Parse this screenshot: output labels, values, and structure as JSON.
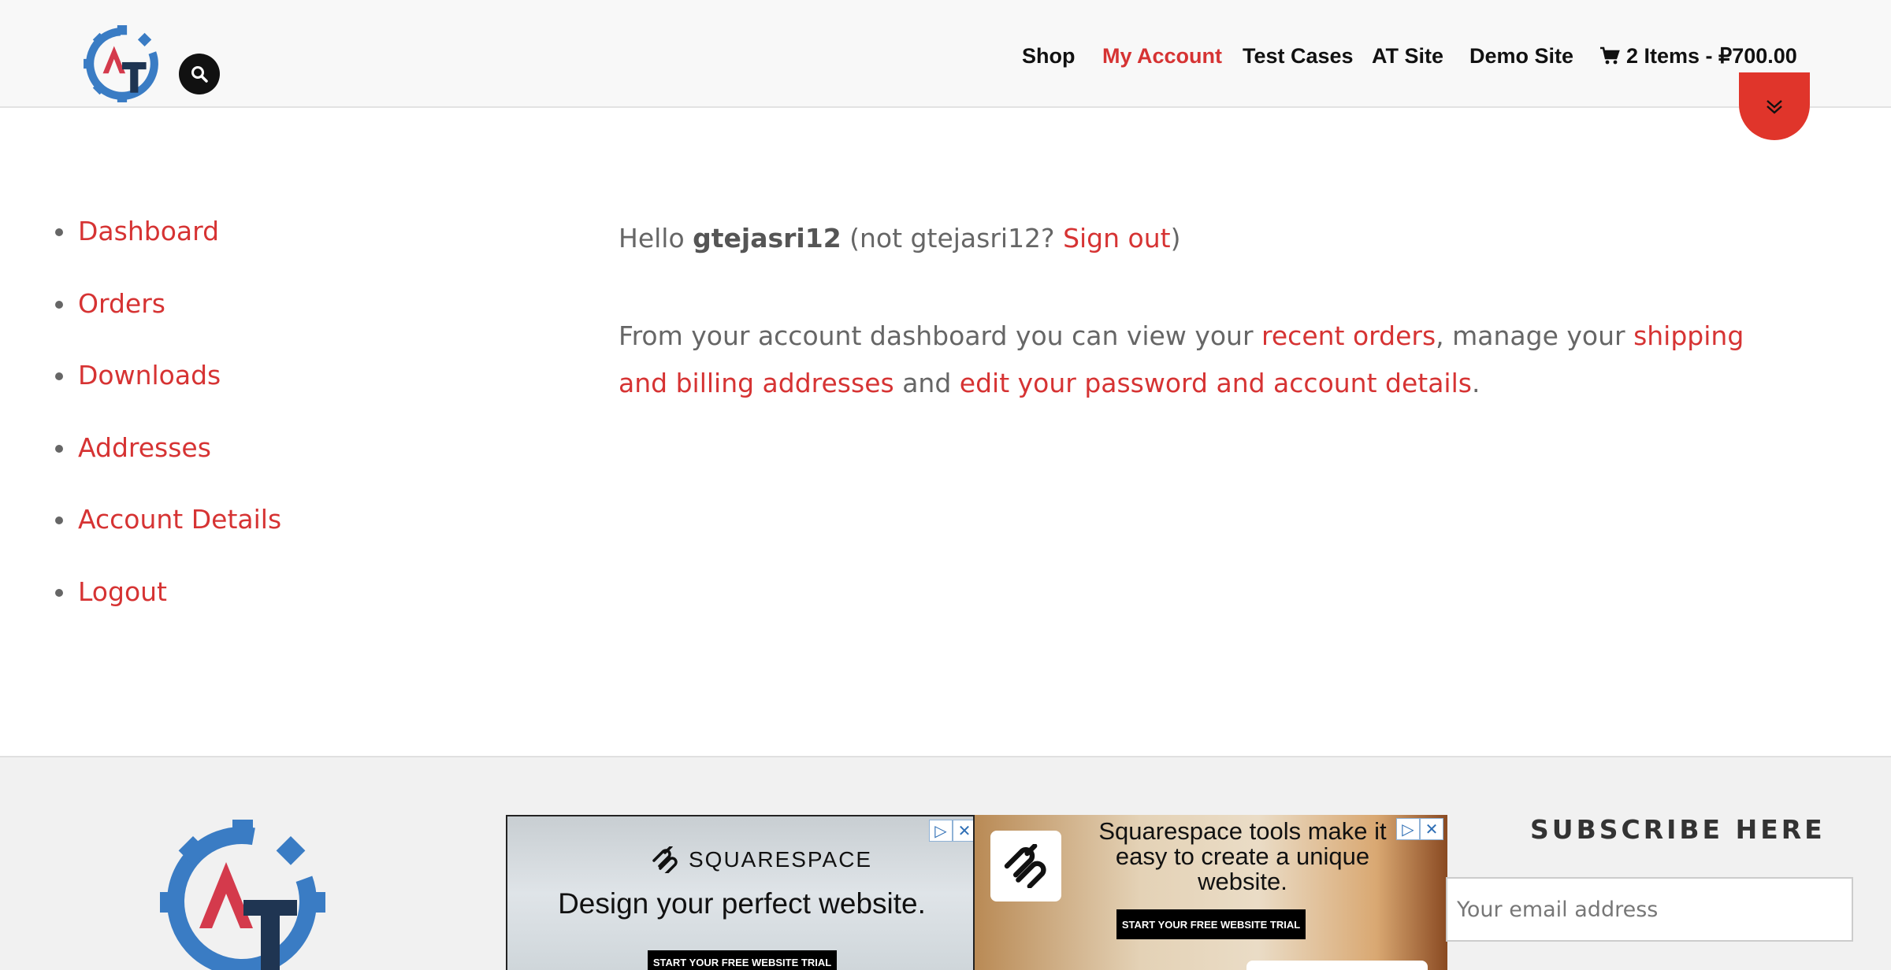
{
  "header": {
    "nav": [
      {
        "label": "Shop",
        "active": false
      },
      {
        "label": "My Account",
        "active": true
      },
      {
        "label": "Test Cases",
        "active": false
      },
      {
        "label": "AT Site",
        "active": false
      },
      {
        "label": "Demo Site",
        "active": false
      }
    ],
    "cart_label": "2 Items - ₽700.00"
  },
  "sidebar": {
    "items": [
      {
        "label": "Dashboard"
      },
      {
        "label": "Orders"
      },
      {
        "label": "Downloads"
      },
      {
        "label": "Addresses"
      },
      {
        "label": "Account Details"
      },
      {
        "label": "Logout"
      }
    ]
  },
  "content": {
    "hello": "Hello ",
    "username": "gtejasri12",
    "not_prefix": " (not gtejasri12? ",
    "signout": "Sign out",
    "not_suffix": ")",
    "intro": "From your account dashboard you can view your ",
    "recent_orders": "recent orders",
    "manage": ", manage your ",
    "addresses_link": "shipping and billing addresses",
    "and": " and ",
    "account_link": "edit your password and account details",
    "period": "."
  },
  "footer": {
    "ad1": {
      "brand": "SQUARESPACE",
      "headline": "Design your perfect website.",
      "cta": "START YOUR FREE WEBSITE TRIAL"
    },
    "ad2": {
      "headline": "Squarespace tools make it easy to create a unique website.",
      "cta": "START YOUR FREE WEBSITE TRIAL"
    },
    "subscribe_title": "SUBSCRIBE HERE",
    "email_placeholder": "Your email address"
  },
  "colors": {
    "accent": "#d63333",
    "logo_blue": "#3a7cc4",
    "logo_red": "#d43a4c",
    "logo_navy": "#1f3552"
  }
}
